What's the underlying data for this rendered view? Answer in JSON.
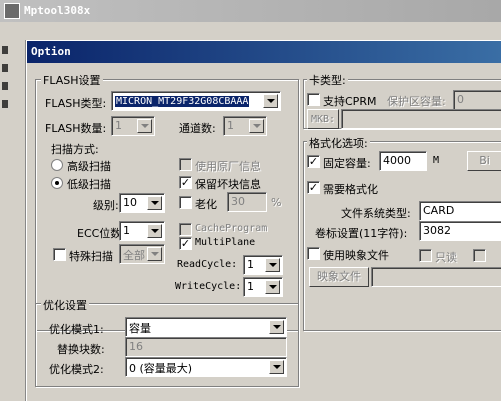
{
  "outer": {
    "title": "Mptool308x"
  },
  "dialog": {
    "title": "Option"
  },
  "flash": {
    "legend": "FLASH设置",
    "type_label": "FLASH类型:",
    "type_value": "MICRON_MT29F32G08CBAAA",
    "count_label": "FLASH数量:",
    "count_value": "1",
    "channel_label": "通道数:",
    "channel_value": "1",
    "scan_label": "扫描方式:",
    "scan_high": "高级扫描",
    "scan_low": "低级扫描",
    "level_label": "级别:",
    "level_value": "10",
    "ecc_label": "ECC位数:",
    "ecc_value": "1",
    "special_scan": "特殊扫描",
    "special_value": "全部",
    "use_factory": "使用原厂信息",
    "keep_bad": "保留坏块信息",
    "aging": "老化",
    "aging_value": "30",
    "aging_unit": "%",
    "cache_program": "CacheProgram",
    "multiplane": "MultiPlane",
    "read_cycle_label": "ReadCycle:",
    "read_cycle_value": "1",
    "write_cycle_label": "WriteCycle:",
    "write_cycle_value": "1"
  },
  "card": {
    "legend": "卡类型:",
    "support_cprm": "支持CPRM",
    "protect_label": "保护区容量:",
    "protect_value": "0",
    "mkb_button": "MKB:"
  },
  "format": {
    "legend": "格式化选项:",
    "fixed_capacity": "固定容量:",
    "capacity_value": "4000",
    "capacity_unit": "M",
    "bi_button": "Bi",
    "need_format": "需要格式化",
    "fs_type_label": "文件系统类型:",
    "fs_type_value": "CARD",
    "volume_label": "卷标设置(11字符):",
    "volume_value": "3082",
    "use_image": "使用映象文件",
    "readonly": "只读",
    "image_button": "映象文件"
  },
  "optimize": {
    "legend": "优化设置",
    "mode1_label": "优化模式1:",
    "mode1_value": "容量",
    "replace_label": "替换块数:",
    "replace_value": "16",
    "mode2_label": "优化模式2:",
    "mode2_value": "0 (容量最大)"
  },
  "checks": {
    "mark": "✓"
  }
}
